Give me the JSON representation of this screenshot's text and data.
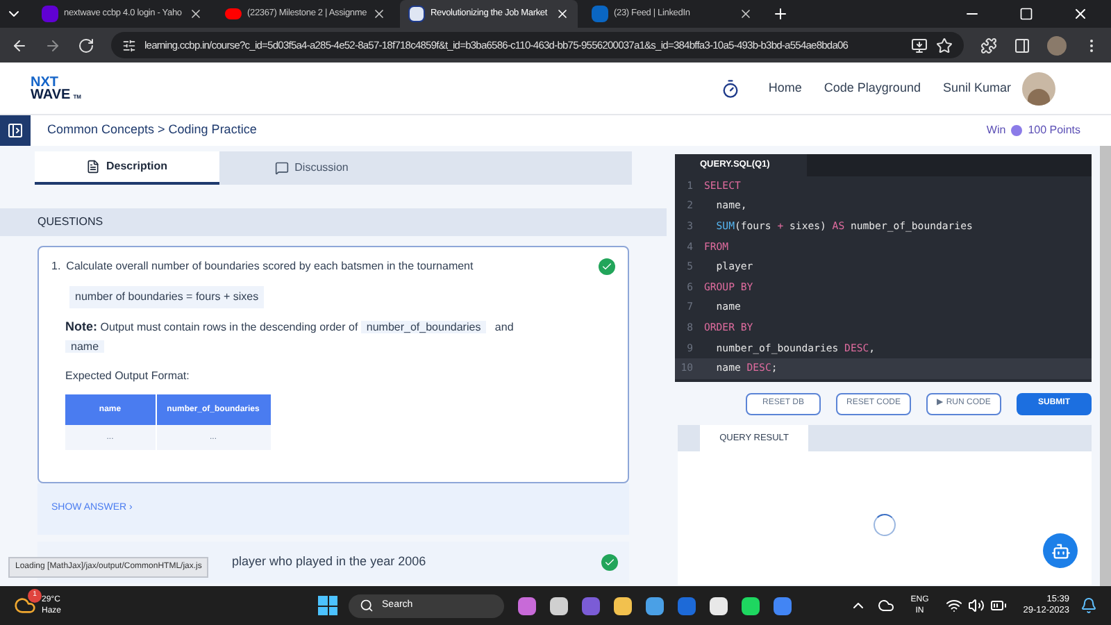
{
  "browser": {
    "tabs": [
      {
        "title": "nextwave ccbp 4.0 login - Yaho",
        "kind": "yahoo",
        "selected": false
      },
      {
        "title": "(22367) Milestone 2 | Assignme",
        "kind": "youtube",
        "selected": false
      },
      {
        "title": "Revolutionizing the Job Market",
        "kind": "page",
        "selected": true
      },
      {
        "title": "(23) Feed | LinkedIn",
        "kind": "linkedin",
        "selected": false
      }
    ],
    "url": "learning.ccbp.in/course?c_id=5d03f5a4-a285-4e52-8a57-18f718c4859f&t_id=b3ba6586-c110-463d-bb75-9556200037a1&s_id=384bffa3-10a5-493b-b3bd-a554ae8bda06"
  },
  "header": {
    "logo": [
      "NXT",
      "WAVE"
    ],
    "logo_mark": "TM",
    "nav": [
      "Home",
      "Code Playground"
    ],
    "user": "Sunil Kumar"
  },
  "breadcrumb": "Common Concepts > Coding Practice",
  "points": {
    "prefix": "Win",
    "value": "100 Points"
  },
  "tabs": [
    {
      "label": "Description",
      "kind": "doc",
      "selected": true
    },
    {
      "label": "Discussion",
      "kind": "chat",
      "selected": false
    }
  ],
  "questions_title": "QUESTIONS",
  "question_1": {
    "number": "1.",
    "text": "Calculate overall number of boundaries scored by each batsmen in the tournament",
    "done": true,
    "formula": "number of boundaries = fours + sixes",
    "note_label": "Note:",
    "note_text": "Output must contain rows in the descending order of",
    "note_code_1": "number_of_boundaries",
    "note_and": "and",
    "note_code_2": "name",
    "format_label": "Expected Output Format:",
    "columns": [
      "name",
      "number_of_boundaries"
    ],
    "rows": [
      [
        "...",
        "..."
      ]
    ],
    "show_answer": "SHOW ANSWER ›"
  },
  "question_2": {
    "text": "player who played in the year 2006",
    "done": true
  },
  "status_message": "Loading [MathJax]/jax/output/CommonHTML/jax.js",
  "editor": {
    "file": "QUERY.SQL(Q1)",
    "lines": [
      {
        "n": "1",
        "active": false,
        "tokens": [
          {
            "t": "SELECT",
            "kind": "keyword"
          }
        ]
      },
      {
        "n": "2",
        "active": false,
        "tokens": [
          {
            "t": "  name,",
            "kind": "plain"
          }
        ]
      },
      {
        "n": "3",
        "active": false,
        "tokens": [
          {
            "t": "  SUM",
            "kind": "function"
          },
          {
            "t": "(fours ",
            "kind": "plain"
          },
          {
            "t": "+",
            "kind": "keyword"
          },
          {
            "t": " sixes) ",
            "kind": "plain"
          },
          {
            "t": "AS",
            "kind": "keyword"
          },
          {
            "t": " number_of_boundaries",
            "kind": "plain"
          }
        ]
      },
      {
        "n": "4",
        "active": false,
        "tokens": [
          {
            "t": "FROM",
            "kind": "keyword"
          }
        ]
      },
      {
        "n": "5",
        "active": false,
        "tokens": [
          {
            "t": "  player",
            "kind": "plain"
          }
        ]
      },
      {
        "n": "6",
        "active": false,
        "tokens": [
          {
            "t": "GROUP BY",
            "kind": "keyword"
          }
        ]
      },
      {
        "n": "7",
        "active": false,
        "tokens": [
          {
            "t": "  name",
            "kind": "plain"
          }
        ]
      },
      {
        "n": "8",
        "active": false,
        "tokens": [
          {
            "t": "ORDER BY",
            "kind": "keyword"
          }
        ]
      },
      {
        "n": "9",
        "active": false,
        "tokens": [
          {
            "t": "  number_of_boundaries ",
            "kind": "plain"
          },
          {
            "t": "DESC",
            "kind": "keyword"
          },
          {
            "t": ",",
            "kind": "plain"
          }
        ]
      },
      {
        "n": "10",
        "active": true,
        "tokens": [
          {
            "t": "  name ",
            "kind": "plain"
          },
          {
            "t": "DESC",
            "kind": "keyword"
          },
          {
            "t": ";",
            "kind": "plain"
          }
        ]
      }
    ]
  },
  "actions": [
    {
      "label": "RESET DB",
      "kind": "outline"
    },
    {
      "label": "RESET CODE",
      "kind": "outline"
    },
    {
      "label": "▶ RUN CODE",
      "kind": "outline"
    },
    {
      "label": "SUBMIT",
      "kind": "primary"
    }
  ],
  "result_tab": "QUERY RESULT",
  "taskbar": {
    "weather_badge": "1",
    "temp": "29°C",
    "condition": "Haze",
    "search": "Search",
    "lang": [
      "ENG",
      "IN"
    ],
    "time": "15:39",
    "date": "29-12-2023"
  }
}
